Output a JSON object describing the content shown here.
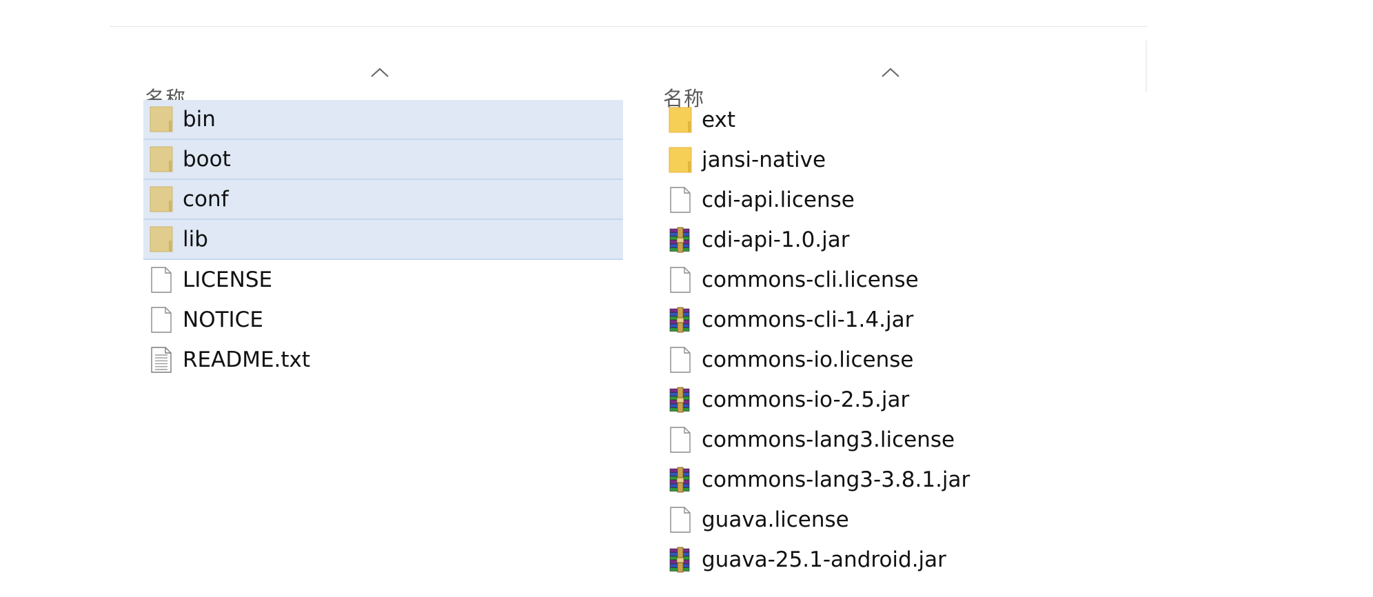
{
  "left_pane": {
    "column_header": "名称",
    "items": [
      {
        "name": "bin",
        "icon": "folder-icon",
        "selected": true
      },
      {
        "name": "boot",
        "icon": "folder-icon",
        "selected": true
      },
      {
        "name": "conf",
        "icon": "folder-icon",
        "selected": true
      },
      {
        "name": "lib",
        "icon": "folder-icon",
        "selected": true
      },
      {
        "name": "LICENSE",
        "icon": "file-icon",
        "selected": false
      },
      {
        "name": "NOTICE",
        "icon": "file-icon",
        "selected": false
      },
      {
        "name": "README.txt",
        "icon": "text-file-icon",
        "selected": false
      }
    ]
  },
  "right_pane": {
    "column_header": "名称",
    "items": [
      {
        "name": "ext",
        "icon": "folder-icon",
        "selected": false
      },
      {
        "name": "jansi-native",
        "icon": "folder-icon",
        "selected": false
      },
      {
        "name": "cdi-api.license",
        "icon": "file-icon",
        "selected": false
      },
      {
        "name": "cdi-api-1.0.jar",
        "icon": "archive-icon",
        "selected": false
      },
      {
        "name": "commons-cli.license",
        "icon": "file-icon",
        "selected": false
      },
      {
        "name": "commons-cli-1.4.jar",
        "icon": "archive-icon",
        "selected": false
      },
      {
        "name": "commons-io.license",
        "icon": "file-icon",
        "selected": false
      },
      {
        "name": "commons-io-2.5.jar",
        "icon": "archive-icon",
        "selected": false
      },
      {
        "name": "commons-lang3.license",
        "icon": "file-icon",
        "selected": false
      },
      {
        "name": "commons-lang3-3.8.1.jar",
        "icon": "archive-icon",
        "selected": false
      },
      {
        "name": "guava.license",
        "icon": "file-icon",
        "selected": false
      },
      {
        "name": "guava-25.1-android.jar",
        "icon": "archive-icon",
        "selected": false
      }
    ]
  },
  "colors": {
    "selection_bg": "#dfe8f4",
    "folder_yellow": "#f6cf57",
    "folder_selected": "#e0cc8c"
  }
}
